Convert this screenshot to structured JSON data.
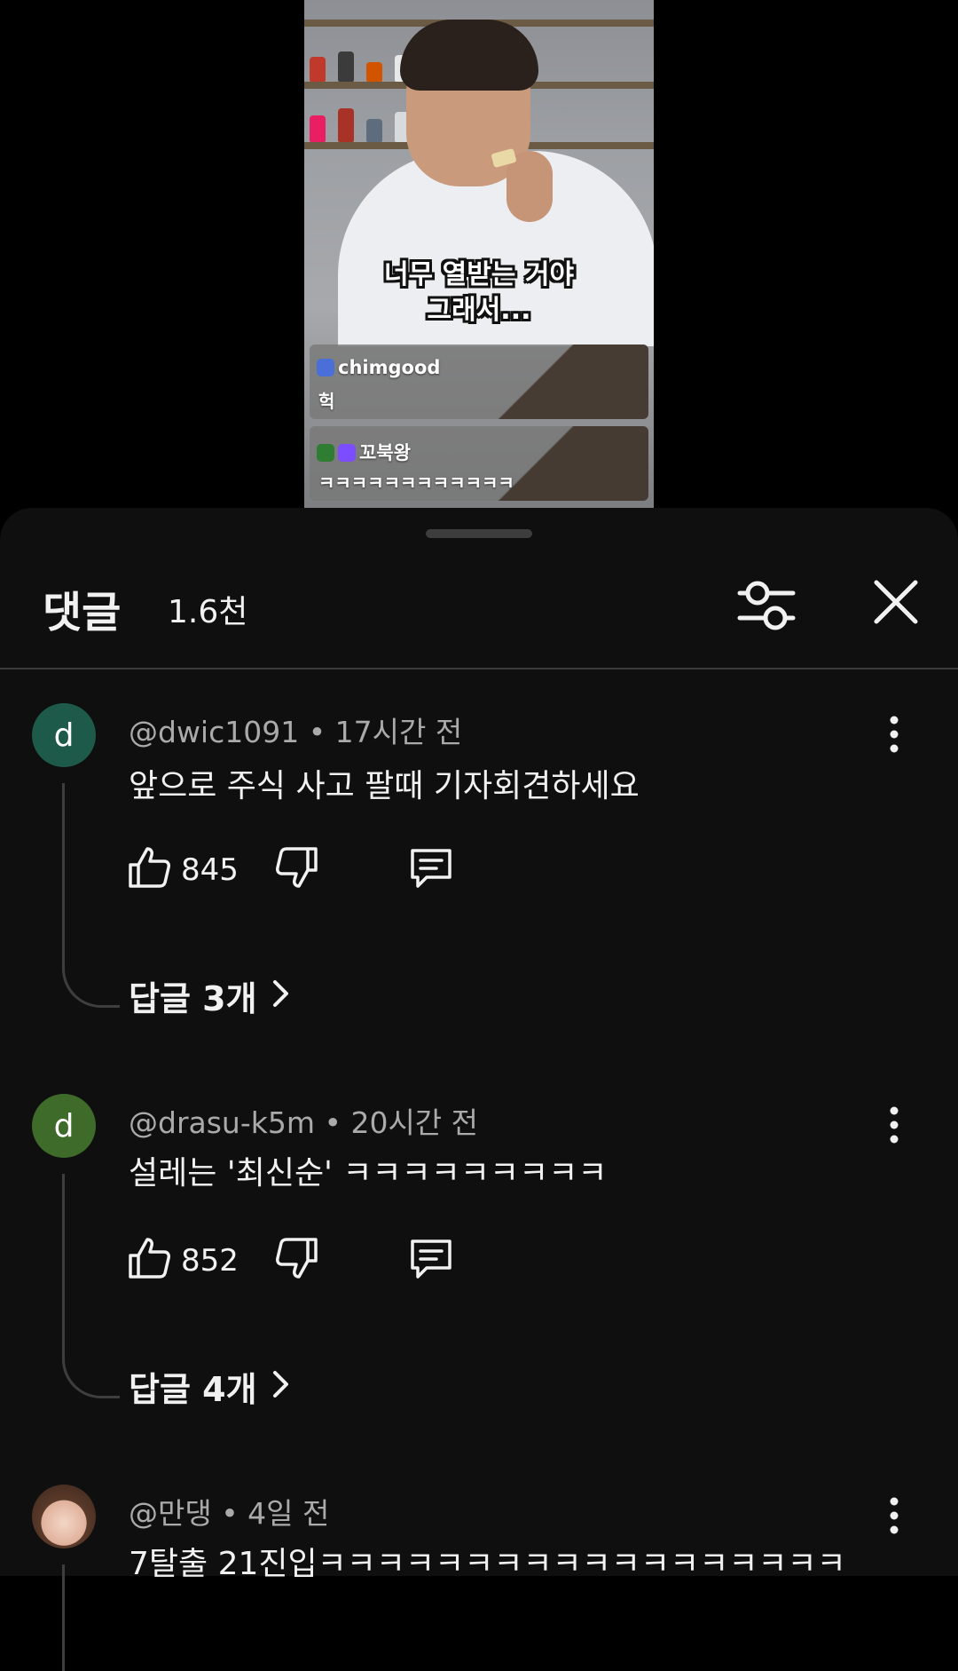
{
  "video": {
    "subtitle_line1": "너무 열받는 거야",
    "subtitle_line2": "그래서...",
    "chat": [
      {
        "user": "chimgood",
        "message": "헉"
      },
      {
        "user": "꼬북왕",
        "message": "ㅋㅋㅋㅋㅋㅋㅋㅋㅋㅋㅋㅋ"
      }
    ]
  },
  "sheet": {
    "title": "댓글",
    "count": "1.6천",
    "filter_icon": "filter-sliders-icon",
    "close_icon": "close-icon"
  },
  "comments": [
    {
      "avatar_letter": "d",
      "avatar_color": "#1e5a4a",
      "meta": "@dwic1091 • 17시간 전",
      "text": "앞으로 주식 사고 팔때 기자회견하세요",
      "likes": "845",
      "replies": "답글 3개"
    },
    {
      "avatar_letter": "d",
      "avatar_color": "#3f6b2a",
      "meta": "@drasu-k5m • 20시간 전",
      "text": "설레는 '최신순' ㅋㅋㅋㅋㅋㅋㅋㅋㅋ",
      "likes": "852",
      "replies": "답글 4개"
    },
    {
      "avatar_letter": "",
      "avatar_color": "#e9c9b8",
      "meta": "@만댕 • 4일 전",
      "text": "7탈출 21진입ㅋㅋㅋㅋㅋㅋㅋㅋㅋㅋㅋㅋㅋㅋㅋㅋㅋㅋ"
    }
  ]
}
